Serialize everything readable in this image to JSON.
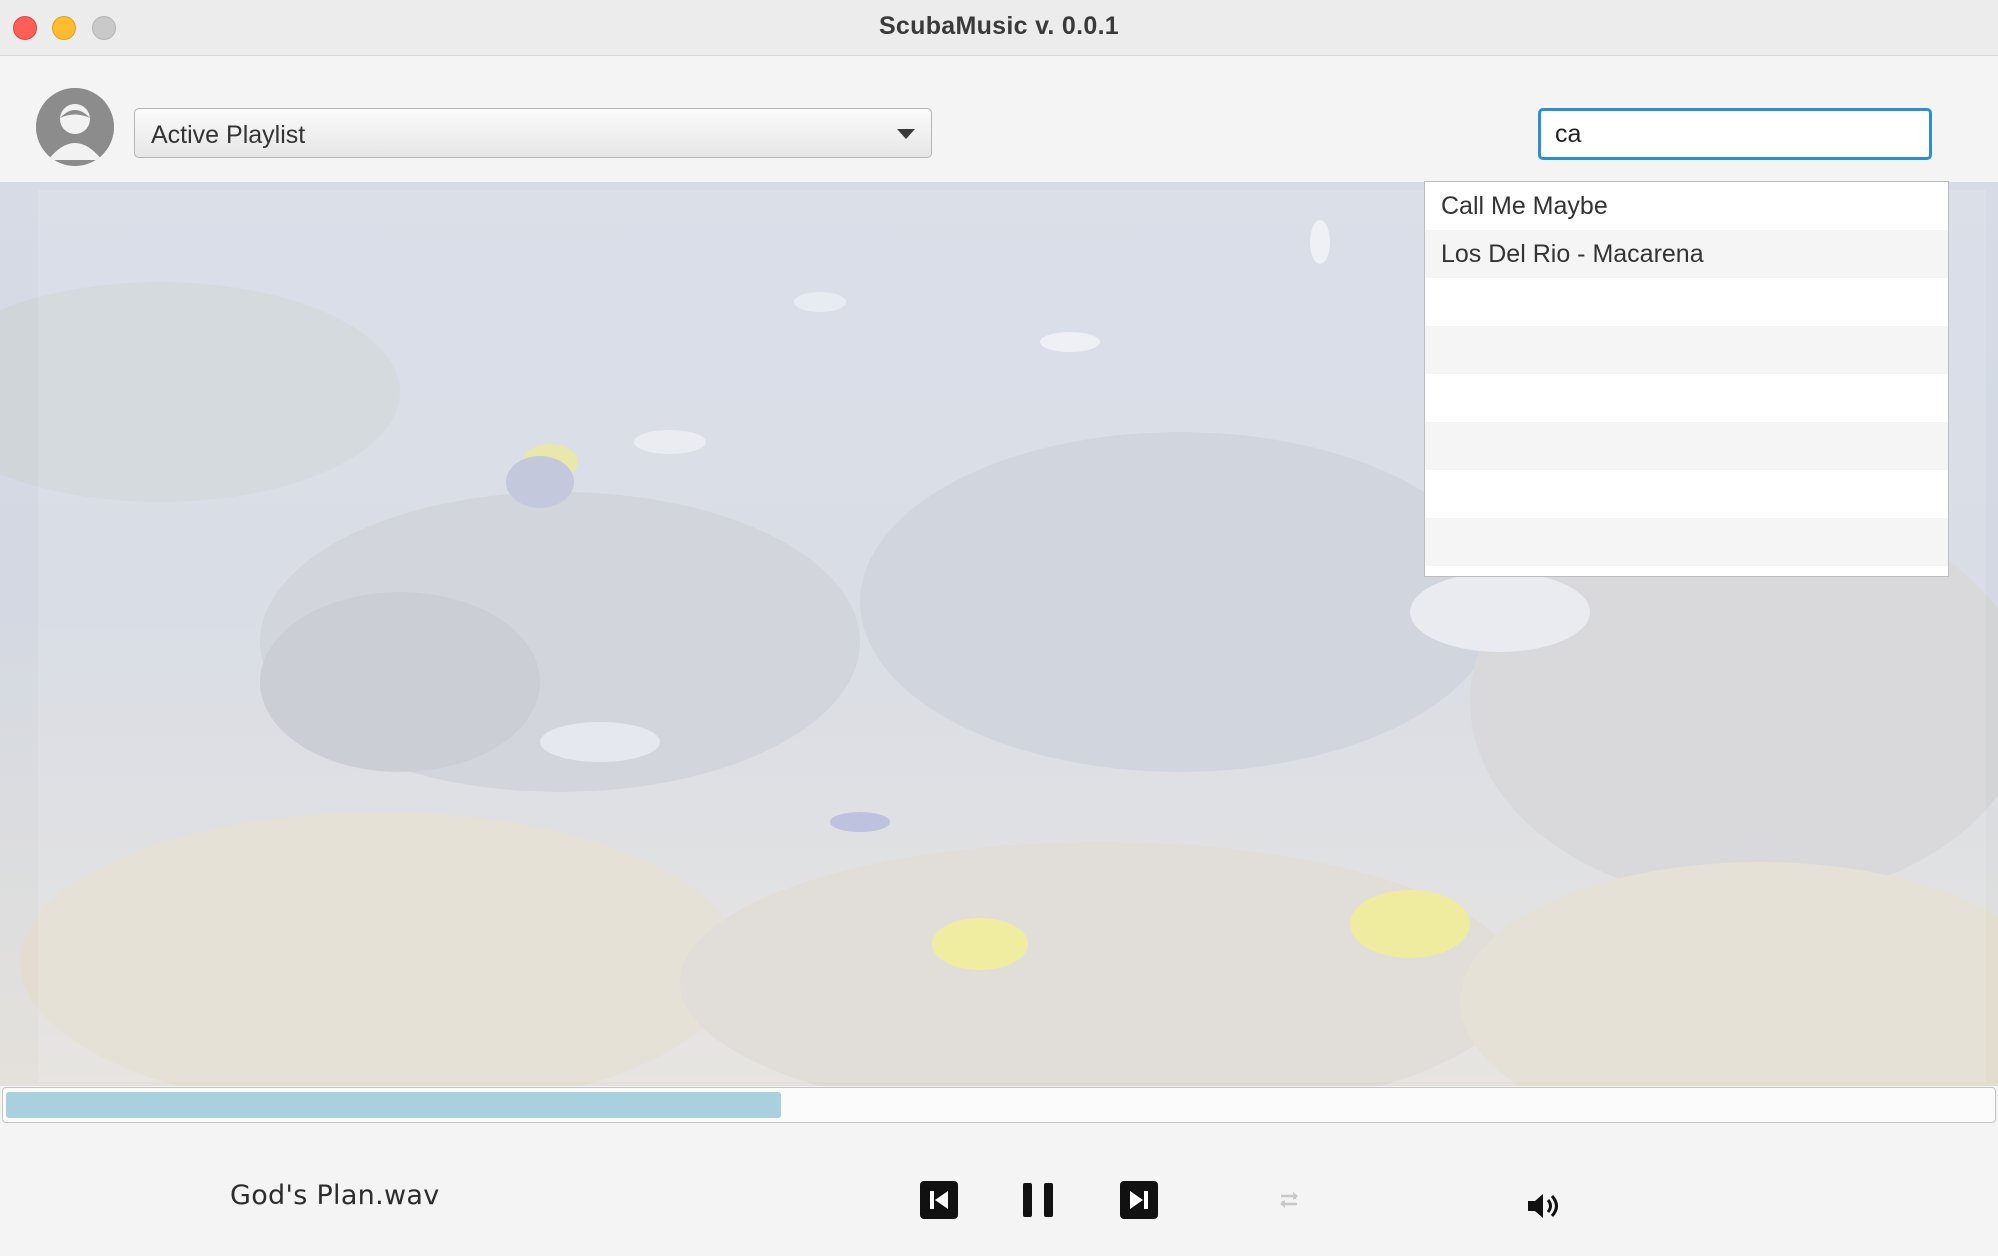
{
  "window": {
    "title": "ScubaMusic v. 0.0.1"
  },
  "toolbar": {
    "playlist_selected": "Active Playlist",
    "search_value": "ca"
  },
  "search_results": [
    "Call Me Maybe",
    "Los Del Rio - Macarena",
    "",
    "",
    "",
    "",
    "",
    ""
  ],
  "playback": {
    "now_playing": "God's Plan.wav",
    "progress": 0.39
  },
  "icons": {
    "avatar": "user-avatar-icon",
    "previous": "skip-previous-icon",
    "pause": "pause-icon",
    "next": "skip-next-icon",
    "repeat": "repeat-icon",
    "volume": "volume-icon"
  },
  "colors": {
    "accent": "#2b8fd8",
    "progress_fill": "#a9d0dd"
  }
}
